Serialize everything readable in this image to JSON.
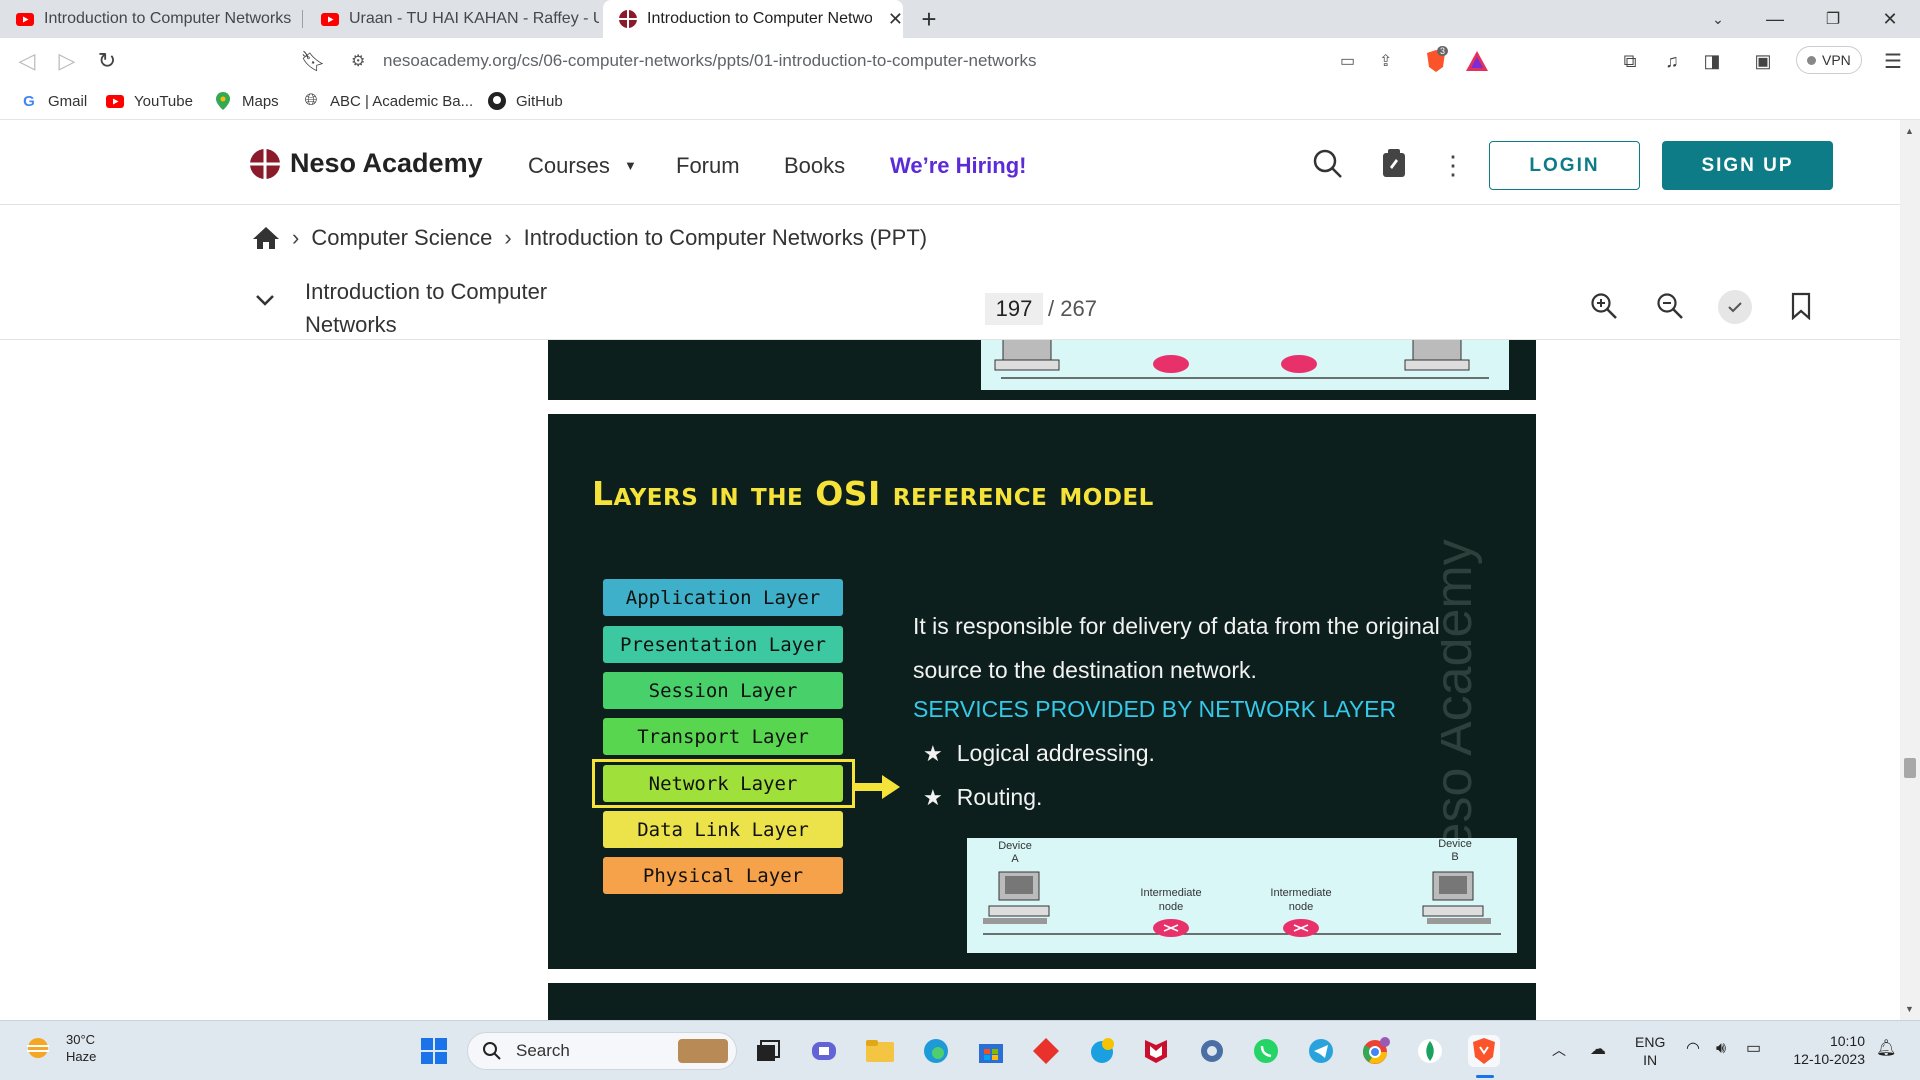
{
  "browser": {
    "tabs": [
      {
        "title": "Introduction to Computer Networks -",
        "icon": "youtube-icon"
      },
      {
        "title": "Uraan - TU HAI KAHAN - Raffey - Usam",
        "icon": "youtube-icon"
      },
      {
        "title": "Introduction to Computer Netwo",
        "icon": "neso-icon"
      }
    ],
    "url": "nesoacademy.org/cs/06-computer-networks/ppts/01-introduction-to-computer-networks",
    "brave_shield_count": "3",
    "vpn_label": "VPN",
    "bookmarks": [
      {
        "label": "Gmail",
        "icon": "google-icon"
      },
      {
        "label": "YouTube",
        "icon": "youtube-icon"
      },
      {
        "label": "Maps",
        "icon": "maps-icon"
      },
      {
        "label": "ABC | Academic Ba...",
        "icon": "globe-icon"
      },
      {
        "label": "GitHub",
        "icon": "github-icon"
      }
    ]
  },
  "site": {
    "brand": "Neso Academy",
    "nav": {
      "courses": "Courses",
      "forum": "Forum",
      "books": "Books",
      "hiring": "We’re Hiring!"
    },
    "login": "LOGIN",
    "signup": "SIGN UP"
  },
  "breadcrumb": {
    "items": [
      "Computer Science",
      "Introduction to Computer Networks (PPT)"
    ]
  },
  "doc": {
    "title": "Introduction to Computer Networks",
    "page_current": "197",
    "page_total": "/ 267"
  },
  "slide": {
    "title": "Layers in the OSI reference model",
    "layers": [
      {
        "label": "Application Layer",
        "color": "#3fb0c9"
      },
      {
        "label": "Presentation Layer",
        "color": "#3cc8a0"
      },
      {
        "label": "Session Layer",
        "color": "#48d06a"
      },
      {
        "label": "Transport Layer",
        "color": "#58d650"
      },
      {
        "label": "Network Layer",
        "color": "#9fe03a"
      },
      {
        "label": "Data Link Layer",
        "color": "#ece24a"
      },
      {
        "label": "Physical Layer",
        "color": "#f5a24a"
      }
    ],
    "highlight_color": "#f5e33a",
    "description": "It is responsible for delivery of data from the original source to the destination network.",
    "services_heading": "SERVICES PROVIDED BY NETWORK LAYER",
    "services": [
      "Logical addressing.",
      "Routing."
    ],
    "watermark": "Neso Academy",
    "diagram": {
      "device_a": "Device A",
      "device_b": "Device B",
      "node1": "Intermediate node",
      "node2": "Intermediate node"
    }
  },
  "taskbar": {
    "weather_temp": "30°C",
    "weather_cond": "Haze",
    "search_placeholder": "Search",
    "lang_top": "ENG",
    "lang_bottom": "IN",
    "time": "10:10",
    "date": "12-10-2023"
  }
}
